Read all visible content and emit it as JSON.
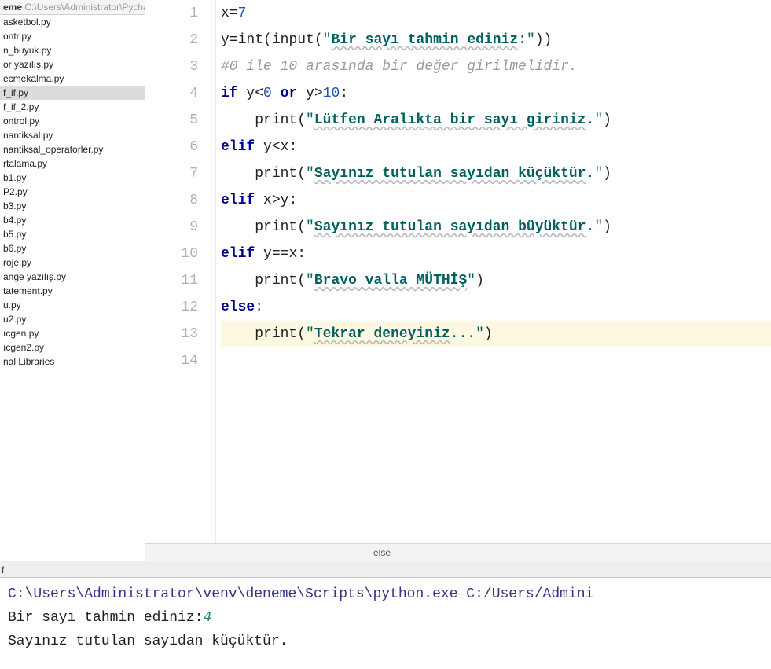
{
  "sidebar": {
    "header_name": "eme",
    "header_path": "C:\\Users\\Administrator\\Pycha",
    "files": [
      "asketbol.py",
      "ontr.py",
      "n_buyuk.py",
      "or yazılış.py",
      "ecmekalma.py",
      "f_if.py",
      "f_if_2.py",
      "ontrol.py",
      "nantiksal.py",
      "nantiksal_operatorler.py",
      "rtalama.py",
      "b1.py",
      "P2.py",
      "b3.py",
      "b4.py",
      "b5.py",
      "b6.py",
      "roje.py",
      "ange yazılış.py",
      "tatement.py",
      "u.py",
      "u2.py",
      "ıcgen.py",
      "ıcgen2.py",
      "nal Libraries"
    ],
    "selected_index": 5
  },
  "code": {
    "lines": [
      {
        "n": 1,
        "seg": [
          [
            "id",
            "x"
          ],
          [
            "op",
            "="
          ],
          [
            "num",
            "7"
          ]
        ]
      },
      {
        "n": 2,
        "seg": [
          [
            "id",
            "y"
          ],
          [
            "op",
            "="
          ],
          [
            "fn",
            "int"
          ],
          [
            "op",
            "("
          ],
          [
            "fn",
            "input"
          ],
          [
            "op",
            "("
          ],
          [
            "strq",
            "\""
          ],
          [
            "str",
            "Bir sayı tahmin ediniz"
          ],
          [
            "strw",
            ":"
          ],
          [
            "strq",
            "\""
          ],
          [
            "op",
            "))"
          ]
        ]
      },
      {
        "n": 3,
        "seg": [
          [
            "cmt",
            "#0 ile 10 arasında bir değer girilmelidir."
          ]
        ]
      },
      {
        "n": 4,
        "seg": [
          [
            "kw",
            "if"
          ],
          [
            "sp",
            " "
          ],
          [
            "id",
            "y"
          ],
          [
            "op",
            "<"
          ],
          [
            "num",
            "0"
          ],
          [
            "sp",
            " "
          ],
          [
            "kw",
            "or"
          ],
          [
            "sp",
            " "
          ],
          [
            "id",
            "y"
          ],
          [
            "op",
            ">"
          ],
          [
            "num",
            "10"
          ],
          [
            "op",
            ":"
          ]
        ]
      },
      {
        "n": 5,
        "seg": [
          [
            "sp",
            "    "
          ],
          [
            "fn",
            "print"
          ],
          [
            "op",
            "("
          ],
          [
            "strq",
            "\""
          ],
          [
            "str",
            "Lütfen Aralıkta bir sayı giriniz"
          ],
          [
            "strw",
            "."
          ],
          [
            "strq",
            "\""
          ],
          [
            "op",
            ")"
          ]
        ]
      },
      {
        "n": 6,
        "seg": [
          [
            "kw",
            "elif"
          ],
          [
            "sp",
            " "
          ],
          [
            "id",
            "y"
          ],
          [
            "op",
            "<"
          ],
          [
            "id",
            "x"
          ],
          [
            "op",
            ":"
          ]
        ]
      },
      {
        "n": 7,
        "seg": [
          [
            "sp",
            "    "
          ],
          [
            "fn",
            "print"
          ],
          [
            "op",
            "("
          ],
          [
            "strq",
            "\""
          ],
          [
            "str",
            "Sayınız tutulan sayıdan küçüktür"
          ],
          [
            "strw",
            "."
          ],
          [
            "strq",
            "\""
          ],
          [
            "op",
            ")"
          ]
        ]
      },
      {
        "n": 8,
        "seg": [
          [
            "kw",
            "elif"
          ],
          [
            "sp",
            " "
          ],
          [
            "id",
            "x"
          ],
          [
            "op",
            ">"
          ],
          [
            "id",
            "y"
          ],
          [
            "op",
            ":"
          ]
        ]
      },
      {
        "n": 9,
        "seg": [
          [
            "sp",
            "    "
          ],
          [
            "fn",
            "print"
          ],
          [
            "op",
            "("
          ],
          [
            "strq",
            "\""
          ],
          [
            "str",
            "Sayınız tutulan sayıdan büyüktür"
          ],
          [
            "strw",
            "."
          ],
          [
            "strq",
            "\""
          ],
          [
            "op",
            ")"
          ]
        ]
      },
      {
        "n": 10,
        "seg": [
          [
            "kw",
            "elif"
          ],
          [
            "sp",
            " "
          ],
          [
            "id",
            "y"
          ],
          [
            "op",
            "=="
          ],
          [
            "id",
            "x"
          ],
          [
            "op",
            ":"
          ]
        ]
      },
      {
        "n": 11,
        "seg": [
          [
            "sp",
            "    "
          ],
          [
            "fn",
            "print"
          ],
          [
            "op",
            "("
          ],
          [
            "strq",
            "\""
          ],
          [
            "str",
            "Bravo valla MÜTHİŞ"
          ],
          [
            "strq",
            "\""
          ],
          [
            "op",
            ")"
          ]
        ]
      },
      {
        "n": 12,
        "seg": [
          [
            "kw",
            "else"
          ],
          [
            "op",
            ":"
          ]
        ]
      },
      {
        "n": 13,
        "current": true,
        "seg": [
          [
            "sp",
            "    "
          ],
          [
            "fn",
            "print"
          ],
          [
            "op",
            "("
          ],
          [
            "strq",
            "\""
          ],
          [
            "str",
            "Tekrar deneyiniz"
          ],
          [
            "strw",
            "..."
          ],
          [
            "strq",
            "\""
          ],
          [
            "op",
            ")"
          ]
        ]
      },
      {
        "n": 14,
        "seg": []
      }
    ]
  },
  "breadcrumb": "else",
  "tab": "f",
  "console": {
    "cmd": "C:\\Users\\Administrator\\venv\\deneme\\Scripts\\python.exe C:/Users/Admini",
    "prompt": "Bir sayı tahmin ediniz:",
    "user_input": "4",
    "output": "Sayınız tutulan sayıdan küçüktür."
  }
}
